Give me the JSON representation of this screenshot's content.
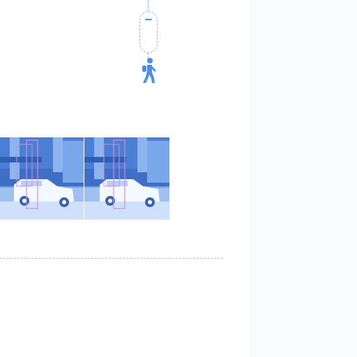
{
  "colors": {
    "accent": "#4a8ee6",
    "dashed_line": "#8fb6ee",
    "image_tint": "#5a8fe0",
    "bbox_highlight": "#d88ad8",
    "background": "#ffffff"
  },
  "icons": {
    "top_node": "capsule-node-icon",
    "walker": "pedestrian-icon"
  },
  "frames": [
    {
      "name": "street-frame-1"
    },
    {
      "name": "street-frame-2"
    }
  ]
}
